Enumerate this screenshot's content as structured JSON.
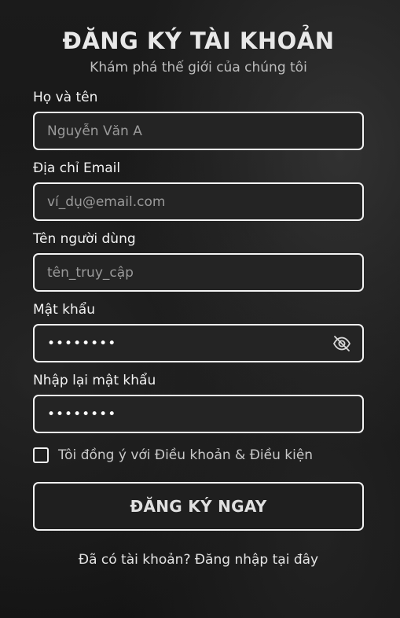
{
  "header": {
    "title": "ĐĂNG KÝ TÀI KHOẢN",
    "subtitle": "Khám phá thế giới của chúng tôi"
  },
  "form": {
    "fullname": {
      "label": "Họ và tên",
      "placeholder": "Nguyễn Văn A",
      "value": ""
    },
    "email": {
      "label": "Địa chỉ Email",
      "placeholder": "ví_dụ@email.com",
      "value": ""
    },
    "username": {
      "label": "Tên người dùng",
      "placeholder": "tên_truy_cập",
      "value": ""
    },
    "password": {
      "label": "Mật khẩu",
      "value": "••••••••",
      "toggle_icon": "eye-off-icon"
    },
    "confirm_password": {
      "label": "Nhập lại mật khẩu",
      "value": "••••••••"
    },
    "agree": {
      "label": "Tôi đồng ý với Điều khoản & Điều kiện",
      "checked": false
    },
    "submit_label": "ĐĂNG KÝ NGAY"
  },
  "footer": {
    "login_text": "Đã có tài khoản? Đăng nhập tại đây"
  },
  "colors": {
    "background": "#1a1a1a",
    "border": "#f4f4f4",
    "placeholder": "#9a9a9a",
    "text": "#ffffff"
  }
}
